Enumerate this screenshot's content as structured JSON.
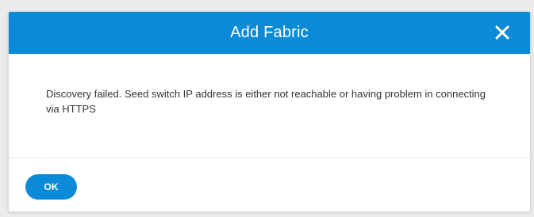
{
  "dialog": {
    "title": "Add Fabric",
    "close_icon": "close-icon",
    "message": "Discovery failed. Seed switch IP address is either not reachable or having problem in connecting via HTTPS",
    "ok_label": "OK"
  },
  "colors": {
    "header": "#0b8bd7",
    "button": "#0b8bd7",
    "background": "#e9ebed",
    "text": "#333333"
  }
}
